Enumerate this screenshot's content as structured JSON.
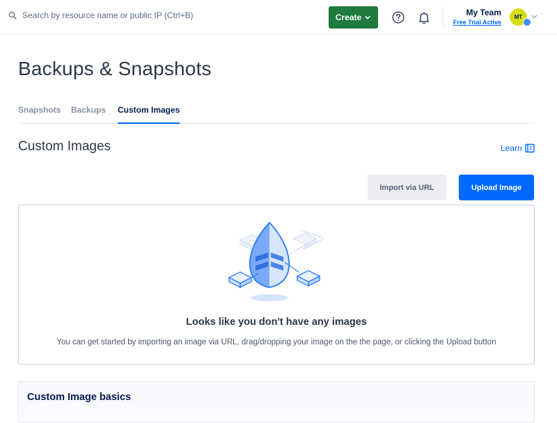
{
  "header": {
    "search_placeholder": "Search by resource name or public IP (Ctrl+B)",
    "create_label": "Create",
    "team_name": "My Team",
    "team_status": "Free Trial Active",
    "avatar_initials": "MT"
  },
  "page": {
    "title": "Backups & Snapshots",
    "tabs": [
      {
        "label": "Snapshots",
        "active": false
      },
      {
        "label": "Backups",
        "active": false
      },
      {
        "label": "Custom Images",
        "active": true
      }
    ]
  },
  "section": {
    "title": "Custom Images",
    "learn_label": "Learn",
    "import_label": "Import via URL",
    "upload_label": "Upload Image"
  },
  "empty_state": {
    "title": "Looks like you don't have any images",
    "description": "You can get started by importing an image via URL, drag/dropping your image on the the page, or clicking the Upload button"
  },
  "basics": {
    "title": "Custom Image basics"
  },
  "colors": {
    "create_button": "#1f7a3d",
    "primary": "#0069ff",
    "avatar": "#d8dc14"
  }
}
